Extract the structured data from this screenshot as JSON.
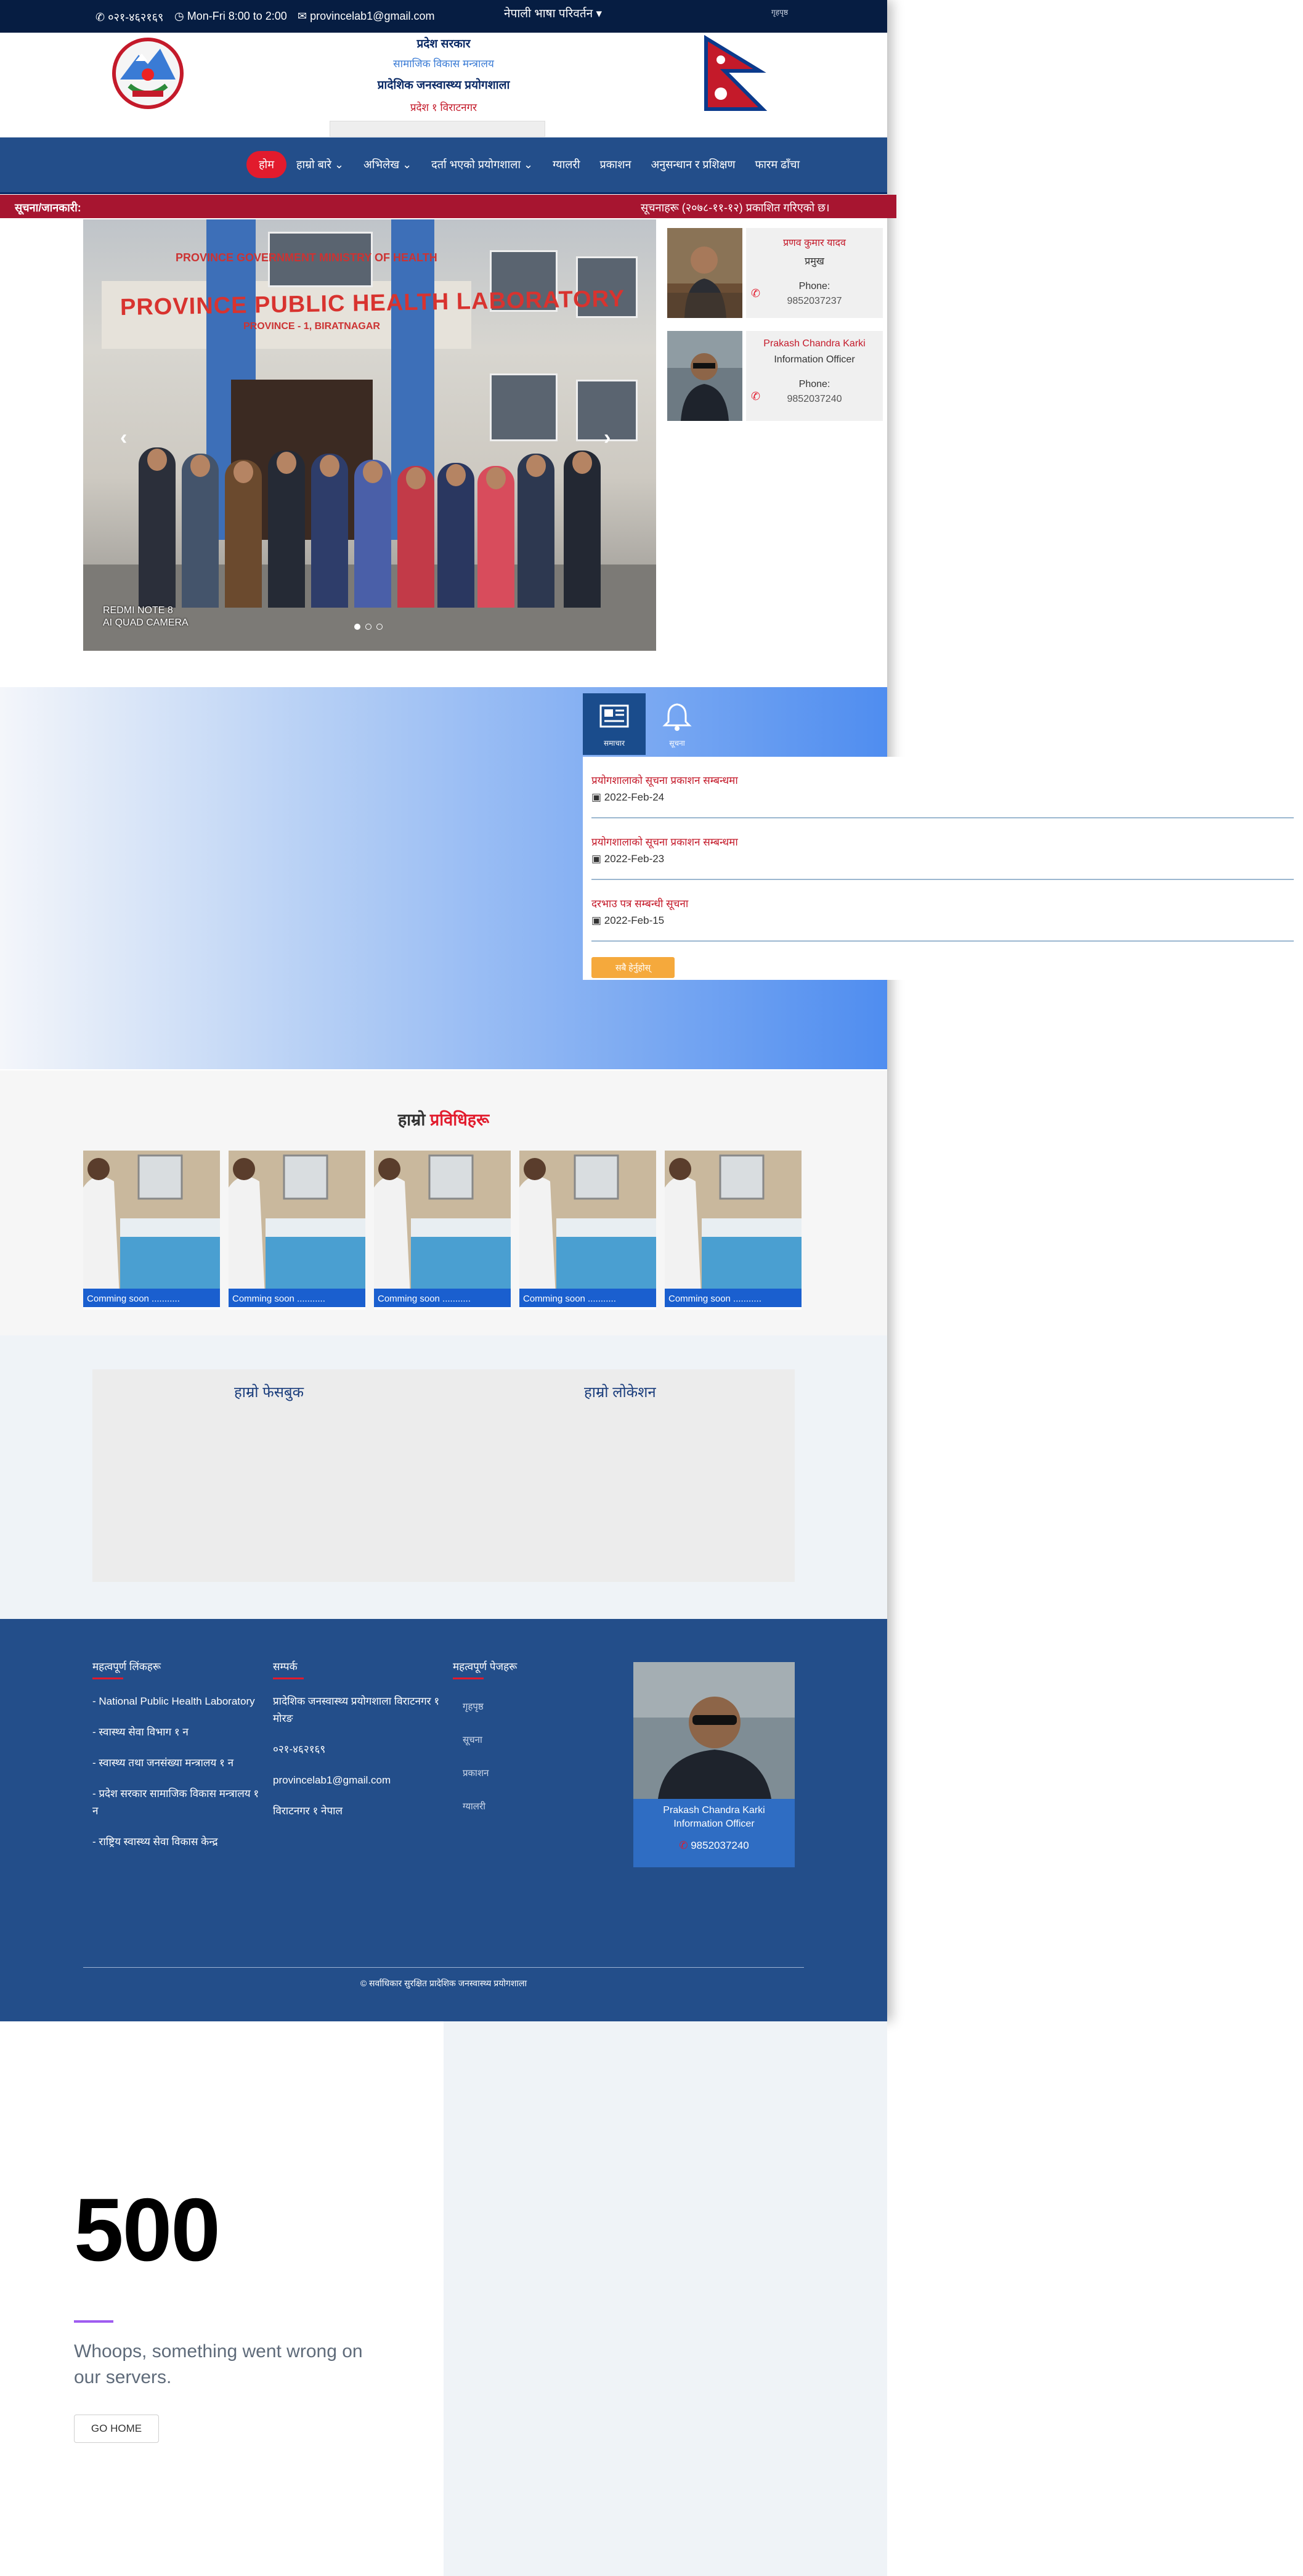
{
  "topbar": {
    "phone": "०२१-४६२१६९",
    "hours": "Mon-Fri 8:00 to 2:00",
    "email": "provincelab1@gmail.com",
    "language": "नेपाली भाषा परिवर्तन",
    "right": "गृहपृष्ठ"
  },
  "header": {
    "line1": "प्रदेश सरकार",
    "line2": "सामाजिक विकास मन्त्रालय",
    "line3": "प्रादेशिक जनस्वास्थ्य प्रयोगशाला",
    "line4": "प्रदेश १ विराटनगर"
  },
  "nav": {
    "items": [
      "होम",
      "हाम्रो बारे",
      "अभिलेख",
      "दर्ता भएको प्रयोगशाला",
      "ग्यालरी",
      "प्रकाशन",
      "अनुसन्धान र प्रशिक्षण",
      "फारम ढाँचा"
    ]
  },
  "ticker": {
    "label": "सूचना/जानकारी:",
    "message": "सूचनाहरू (२०७८-११-१२) प्रकाशित गरिएको छ।"
  },
  "slider": {
    "sign_main": "PROVINCE PUBLIC HEALTH LABORATORY",
    "sign_top": "PROVINCE GOVERNMENT MINISTRY OF HEALTH",
    "sign_sub": "PROVINCE - 1, BIRATNAGAR",
    "caption1": "REDMI NOTE 8",
    "caption2": "AI QUAD CAMERA"
  },
  "staff": [
    {
      "name": "प्रणव कुमार यादव",
      "designation": "प्रमुख",
      "phone_label": "Phone:",
      "phone": "9852037237"
    },
    {
      "name": "Prakash Chandra Karki",
      "designation": "Information Officer",
      "phone_label": "Phone:",
      "phone": "9852037240"
    }
  ],
  "tabs": [
    {
      "label": "समाचार",
      "icon": "newspaper-icon"
    },
    {
      "label": "सूचना",
      "icon": "bell-icon"
    }
  ],
  "news": [
    {
      "title": "प्रयोगशालाको सूचना प्रकाशन सम्बन्धमा",
      "date": "2022-Feb-24"
    },
    {
      "title": "प्रयोगशालाको सूचना प्रकाशन सम्बन्धमा",
      "date": "2022-Feb-23"
    },
    {
      "title": "दरभाउ पत्र सम्बन्धी सूचना",
      "date": "2022-Feb-15"
    }
  ],
  "news_more": "सबै हेर्नुहोस्",
  "tech": {
    "title_prefix": "हाम्रो",
    "title_highlight": "प्रविधिहरू",
    "cards": [
      "Comming soon ...........",
      "Comming soon ...........",
      "Comming soon ...........",
      "Comming soon ...........",
      "Comming soon ..........."
    ]
  },
  "fbloc": {
    "facebook": "हाम्रो फेसबुक",
    "location": "हाम्रो लोकेशन"
  },
  "footer": {
    "links_heading": "महत्वपूर्ण लिंकहरू",
    "links": [
      "- National Public Health Laboratory",
      "- स्वास्थ्य सेवा विभाग १ न",
      "- स्वास्थ्य तथा जनसंख्या मन्त्रालय १ न",
      "- प्रदेश सरकार सामाजिक विकास मन्त्रालय १ न",
      "- राष्ट्रिय स्वास्थ्य सेवा विकास केन्द्र"
    ],
    "contact_heading": "सम्पर्क",
    "contact": [
      "प्रादेशिक जनस्वास्थ्य प्रयोगशाला विराटनगर १ मोरङ",
      "०२१-४६२१६९",
      "provincelab1@gmail.com",
      "विराटनगर १ नेपाल"
    ],
    "pages_heading": "महत्वपूर्ण पेजहरू",
    "pages": [
      "गृहपृष्ठ",
      "सूचना",
      "प्रकाशन",
      "ग्यालरी"
    ],
    "profile_name": "Prakash Chandra Karki",
    "profile_designation": "Information Officer",
    "profile_phone": "9852037240",
    "copyright": "© सर्वाधिकार सुरक्षित प्रादेशिक जनस्वास्थ्य प्रयोगशाला"
  },
  "error": {
    "code": "500",
    "message": "Whoops, something went wrong on our servers.",
    "button": "GO HOME"
  },
  "colors": {
    "navy": "#061d42",
    "nav_blue": "#234e8a",
    "red": "#e21b2d",
    "ticker": "#a71530",
    "accent_purple": "#9f5df0"
  }
}
